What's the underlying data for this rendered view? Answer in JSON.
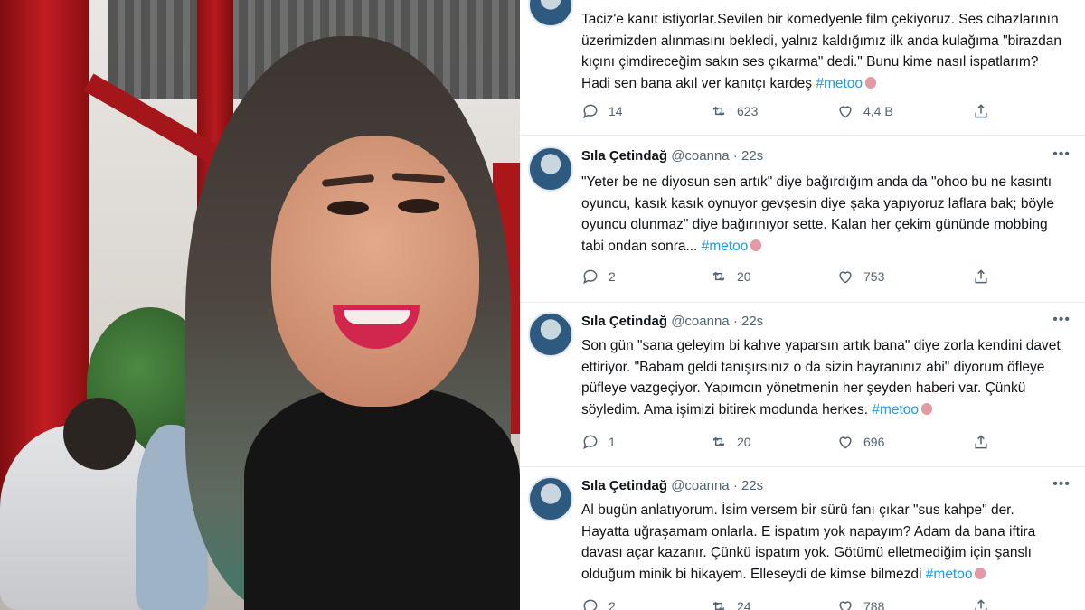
{
  "tweets": [
    {
      "name": "",
      "handle": "",
      "time": "",
      "text_lines": [
        "Taciz'e kanıt istiyorlar.Sevilen bir komedyenle film çekiyoruz. Ses cihazlarının",
        "üzerimizden alınmasını bekledi, yalnız kaldığımız ilk anda kulağıma \"birazdan",
        "kıçını çimdireceğim sakın ses çıkarma\" dedi.\" Bunu kime nasıl ispatlarım?",
        "Hadi sen bana akıl ver kanıtçı kardeş"
      ],
      "hashtag": "#metoo",
      "replies": "14",
      "retweets": "623",
      "likes": "4,4 B"
    },
    {
      "name": "Sıla Çetindağ",
      "handle": "@coanna",
      "time": "· 22s",
      "text_lines": [
        "\"Yeter be ne diyosun sen artık\" diye bağırdığım anda da \"ohoo bu ne kasıntı",
        "oyuncu, kasık kasık oynuyor gevşesin diye şaka yapıyoruz laflara bak; böyle",
        "oyuncu olunmaz\" diye bağırınıyor sette. Kalan her çekim gününde mobbing",
        "tabi ondan sonra..."
      ],
      "hashtag": "#metoo",
      "replies": "2",
      "retweets": "20",
      "likes": "753"
    },
    {
      "name": "Sıla Çetindağ",
      "handle": "@coanna",
      "time": "· 22s",
      "text_lines": [
        "Son gün \"sana geleyim bi kahve yaparsın artık bana\" diye zorla kendini davet",
        "ettiriyor. \"Babam geldi tanışırsınız o da sizin hayranınız abi\" diyorum öfleye",
        "püfleye vazgeçiyor. Yapımcın yönetmenin her şeyden haberi var. Çünkü",
        "söyledim. Ama işimizi bitirek modunda herkes."
      ],
      "hashtag": "#metoo",
      "replies": "1",
      "retweets": "20",
      "likes": "696"
    },
    {
      "name": "Sıla Çetindağ",
      "handle": "@coanna",
      "time": "· 22s",
      "text_lines": [
        "Al bugün anlatıyorum. İsim versem bir sürü fanı çıkar \"sus kahpe\" der.",
        "Hayatta uğraşamam onlarla. E ispatım yok napayım? Adam da bana iftira",
        "davası açar kazanır. Çünkü ispatım yok. Götümü elletmediğim için şanslı",
        "olduğum minik bi hikayem. Elleseydi de kimse bilmezdi"
      ],
      "hashtag": "#metoo",
      "replies": "2",
      "retweets": "24",
      "likes": "788"
    }
  ],
  "colors": {
    "hashtag": "#1d9bf0",
    "text": "#0f1419",
    "muted": "#536471"
  },
  "icons": [
    "reply-icon",
    "retweet-icon",
    "like-icon",
    "share-icon",
    "more-icon",
    "heart-emoji-icon"
  ]
}
